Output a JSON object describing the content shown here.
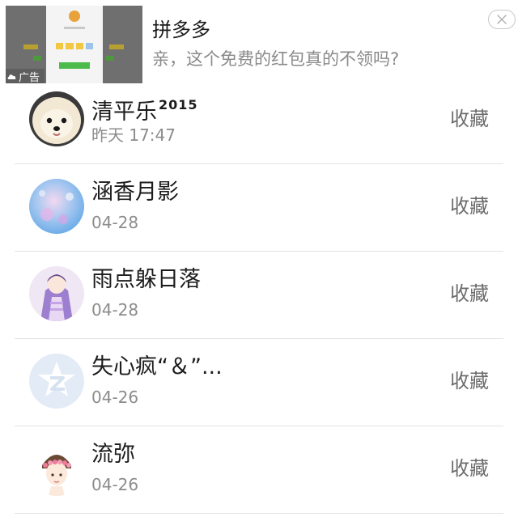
{
  "ad": {
    "label": "广告",
    "title": "拼多多",
    "description": "亲，这个免费的红包真的不领吗?"
  },
  "contacts": [
    {
      "name": "清平乐",
      "name_sup": "2015",
      "date": "昨天 17:47",
      "action": "收藏"
    },
    {
      "name": "涵香月影",
      "date": "04-28",
      "action": "收藏"
    },
    {
      "name": "雨点躲日落",
      "date": "04-28",
      "action": "收藏"
    },
    {
      "name": "失心疯“＆”...",
      "date": "04-26",
      "action": "收藏"
    },
    {
      "name": "流弥",
      "date": "04-26",
      "action": "收藏"
    }
  ],
  "colors": {
    "background": "#ffffff",
    "divider": "#e4e4e4",
    "name_text": "#1c1c1c",
    "meta_text": "#8c8c8c",
    "action_text": "#6c6c6c"
  }
}
